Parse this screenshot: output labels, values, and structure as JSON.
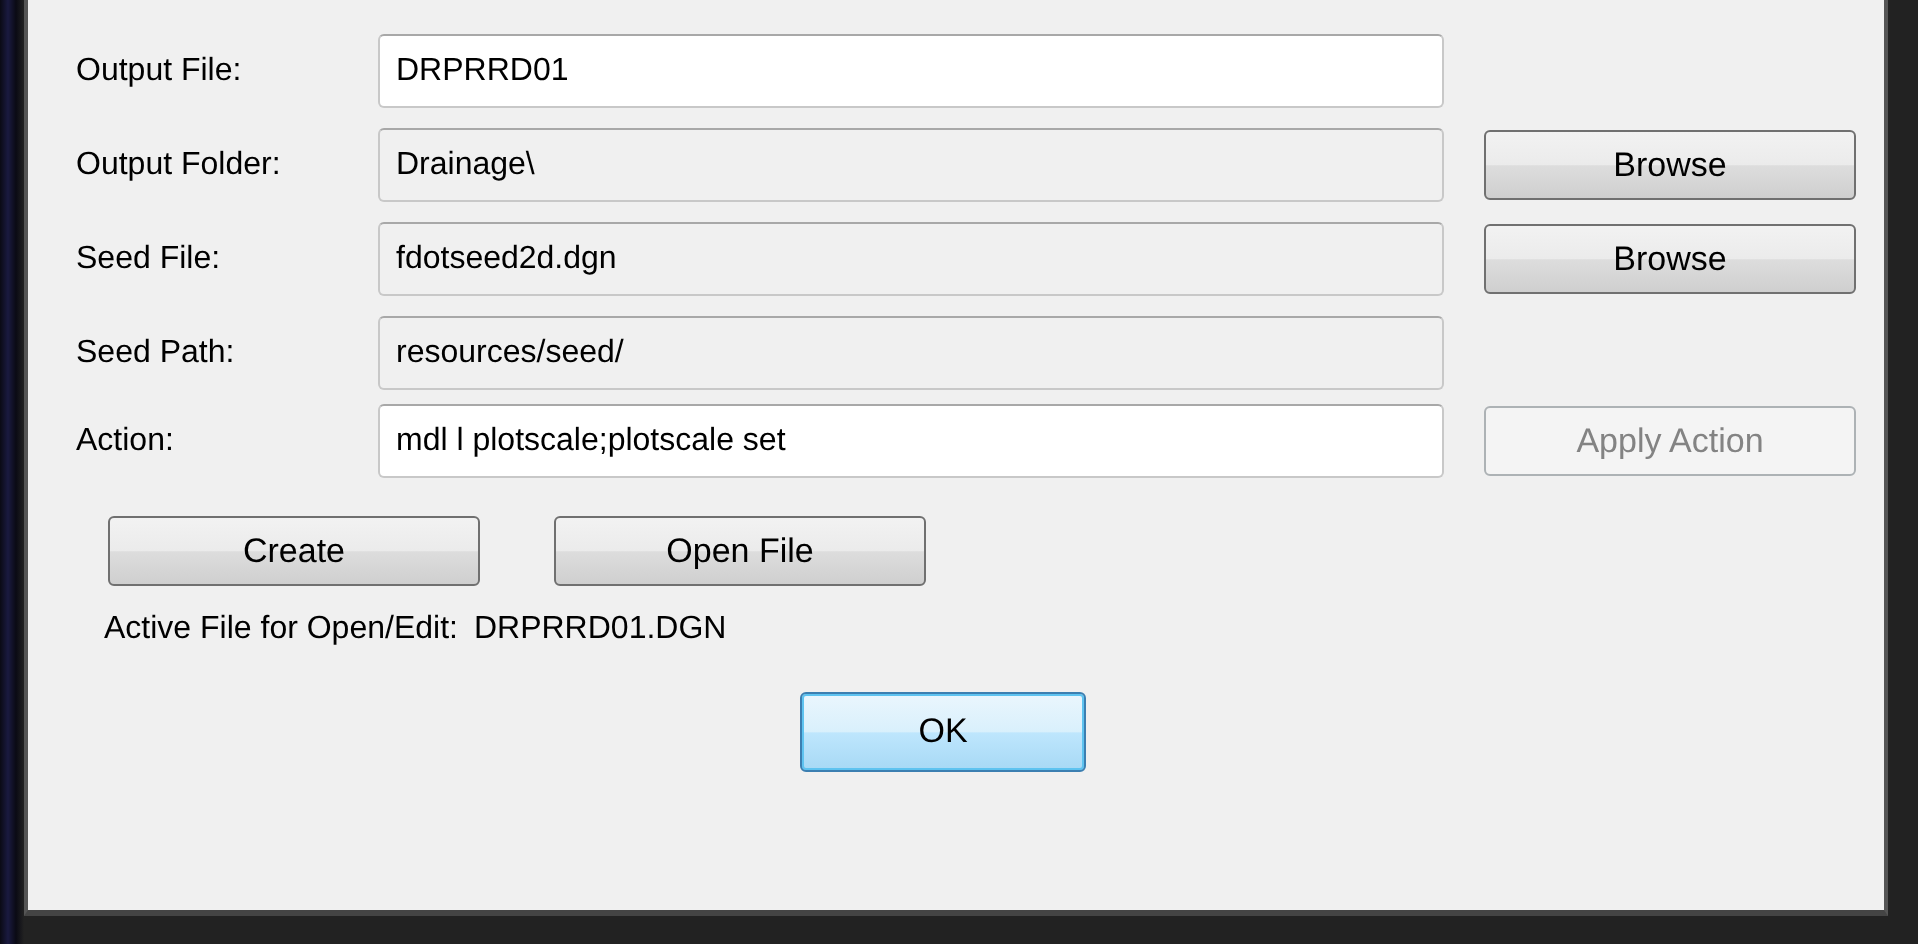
{
  "fields": [
    {
      "label": "Output File:",
      "value": "DRPRRD01",
      "editable": true
    },
    {
      "label": "Output Folder:",
      "value": "Drainage\\",
      "editable": false,
      "button": {
        "label": "Browse",
        "disabled": false
      }
    },
    {
      "label": "Seed File:",
      "value": "fdotseed2d.dgn",
      "editable": false,
      "button": {
        "label": "Browse",
        "disabled": false
      }
    },
    {
      "label": "Seed Path:",
      "value": "resources/seed/",
      "editable": false
    },
    {
      "label": "Action:",
      "value": "mdl l plotscale;plotscale set",
      "editable": true,
      "button": {
        "label": "Apply Action",
        "disabled": true
      }
    }
  ],
  "actions": [
    {
      "label": "Create"
    },
    {
      "label": "Open File"
    }
  ],
  "active_file": {
    "label": "Active File for Open/Edit:",
    "value": "DRPRRD01.DGN"
  },
  "ok_button": {
    "label": "OK",
    "default": true
  }
}
